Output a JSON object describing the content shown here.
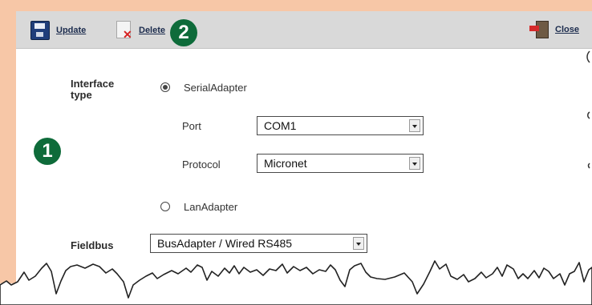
{
  "toolbar": {
    "update_label": "Update",
    "delete_label": "Delete",
    "close_label": "Close",
    "icons": {
      "update": "save-icon",
      "delete": "delete-icon",
      "close": "exit-door-icon"
    }
  },
  "callouts": {
    "left_number": "1",
    "toolbar_number": "2"
  },
  "form": {
    "interface_type_label": "Interface\ntype",
    "options": {
      "serial": {
        "label": "SerialAdapter",
        "selected": true
      },
      "lan": {
        "label": "LanAdapter",
        "selected": false
      }
    },
    "port": {
      "label": "Port",
      "value": "COM1"
    },
    "protocol": {
      "label": "Protocol",
      "value": "Micronet"
    },
    "fieldbus": {
      "label": "Fieldbus",
      "value": "BusAdapter / Wired RS485"
    }
  },
  "colors": {
    "accent_peach": "#f7c7a7",
    "badge_green": "#0e6b3a",
    "toolbar_gray": "#d9d9d9"
  }
}
